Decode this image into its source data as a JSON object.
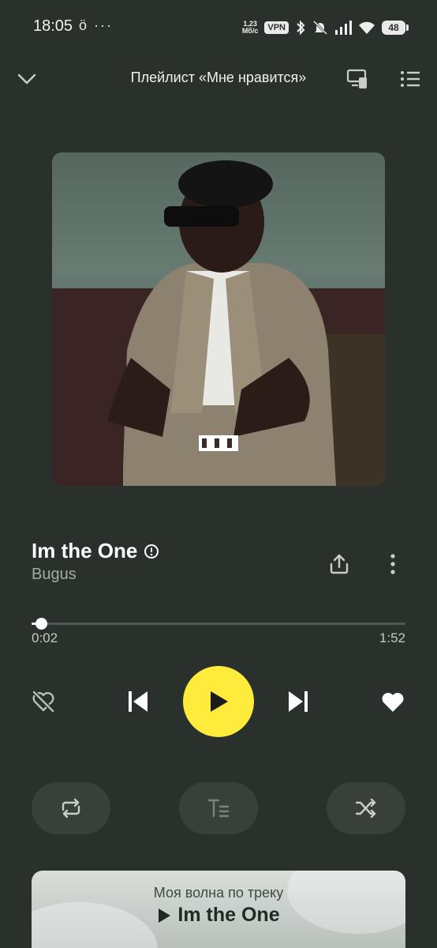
{
  "status_bar": {
    "time": "18:05",
    "extra": "ö ···",
    "net_speed_value": "1,23",
    "net_speed_unit": "Мб/с",
    "vpn": "VPN",
    "battery": "48"
  },
  "header": {
    "title": "Плейлист «Мне нравится»"
  },
  "track": {
    "title": "Im the One",
    "artist": "Bugus",
    "cover_logo": "explicit-label-logo"
  },
  "progress": {
    "elapsed": "0:02",
    "total": "1:52",
    "fraction": 0.018
  },
  "my_wave": {
    "subtitle": "Моя волна по треку",
    "track": "Im the One"
  },
  "colors": {
    "background": "#2a312d",
    "play_button": "#ffeb3b",
    "pill": "#39403c",
    "muted_text": "#a3aaa6"
  },
  "icons": {
    "collapse": "chevron-down-icon",
    "cast": "cast-device-icon",
    "queue": "queue-list-icon",
    "explicit": "explicit-info-icon",
    "share": "share-icon",
    "more": "more-vertical-icon",
    "dislike": "dislike-heart-icon",
    "prev": "skip-previous-icon",
    "play": "play-icon",
    "next": "skip-next-icon",
    "like": "heart-icon",
    "repeat": "repeat-icon",
    "lyrics": "lyrics-icon",
    "shuffle": "shuffle-icon"
  }
}
